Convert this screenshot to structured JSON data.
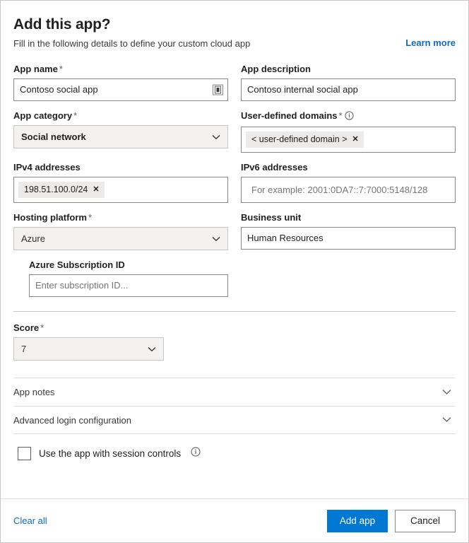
{
  "header": {
    "title": "Add this app?",
    "subtitle": "Fill in the following details to define your custom cloud app",
    "learn_more": "Learn more"
  },
  "fields": {
    "app_name": {
      "label": "App name",
      "required": "*",
      "value": "Contoso social app",
      "icon": "picker-icon"
    },
    "app_description": {
      "label": "App description",
      "value": "Contoso internal social app"
    },
    "app_category": {
      "label": "App category",
      "required": "*",
      "value": "Social network"
    },
    "user_defined_domains": {
      "label": "User-defined domains",
      "required": "*",
      "info": "info-icon",
      "chips": [
        {
          "text": "< user-defined domain >",
          "remove": "✕"
        }
      ]
    },
    "ipv4_addresses": {
      "label": "IPv4 addresses",
      "chips": [
        {
          "text": "198.51.100.0/24",
          "remove": "✕"
        }
      ]
    },
    "ipv6_addresses": {
      "label": "IPv6 addresses",
      "placeholder": "For example: 2001:0DA7::7:7000:5148/128",
      "value": ""
    },
    "hosting_platform": {
      "label": "Hosting platform",
      "required": "*",
      "value": "Azure"
    },
    "business_unit": {
      "label": "Business unit",
      "value": "Human Resources"
    },
    "azure_subscription_id": {
      "label": "Azure Subscription ID",
      "placeholder": "Enter subscription ID...",
      "value": ""
    },
    "score": {
      "label": "Score",
      "required": "*",
      "value": "7"
    }
  },
  "accordions": [
    {
      "label": "App notes"
    },
    {
      "label": "Advanced login configuration"
    }
  ],
  "session_controls": {
    "label": "Use the app with session controls",
    "checked": false,
    "info": "info-icon"
  },
  "footer": {
    "clear_all": "Clear all",
    "submit": "Add app",
    "cancel": "Cancel"
  },
  "colors": {
    "accent": "#0078d4",
    "link": "#0f6cbd",
    "border": "#8a8886",
    "field_bg": "#f3f2f1",
    "chip_bg": "#edebe9"
  }
}
